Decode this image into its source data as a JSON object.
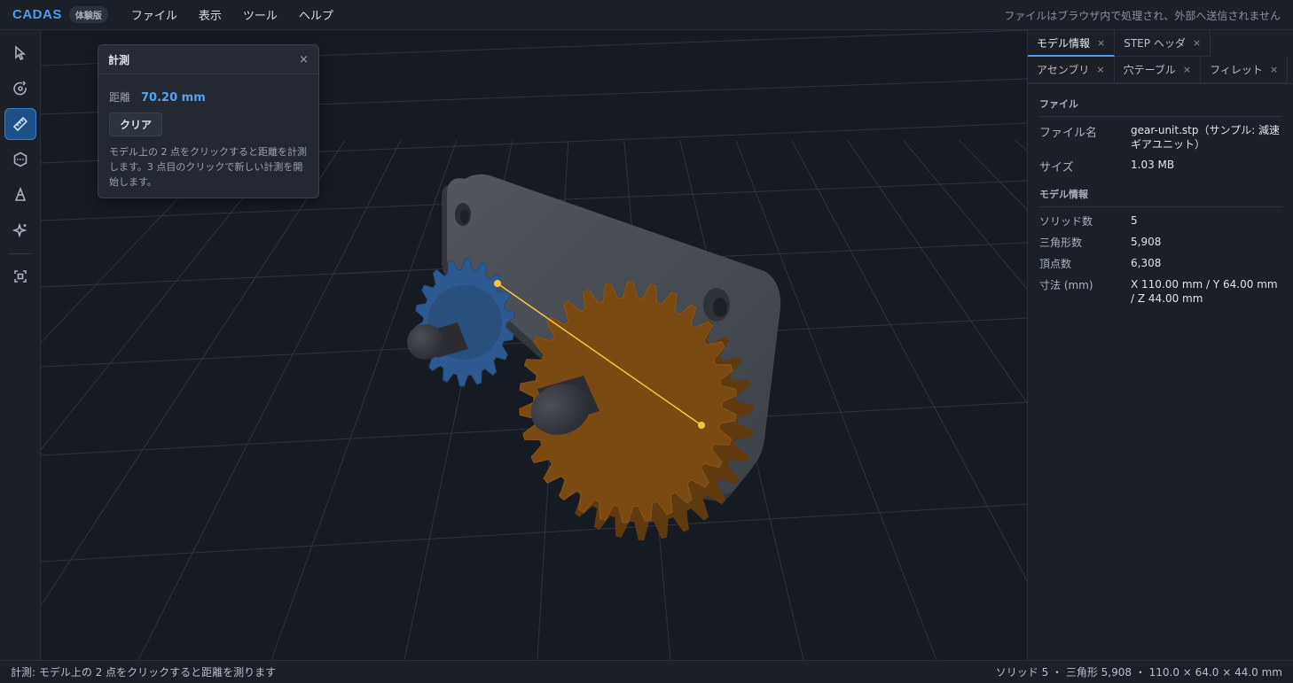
{
  "app": {
    "logo": "CADAS",
    "trial_badge": "体験版",
    "privacy_note": "ファイルはブラウザ内で処理され、外部へ送信されません"
  },
  "menu": [
    "ファイル",
    "表示",
    "ツール",
    "ヘルプ"
  ],
  "toolbar": {
    "tools": [
      {
        "name": "select-icon"
      },
      {
        "name": "orbit-icon"
      },
      {
        "name": "ruler-icon",
        "active": true
      },
      {
        "name": "section-icon"
      },
      {
        "name": "cone-icon"
      },
      {
        "name": "sparkle-icon"
      },
      {
        "name": "fit-view-icon"
      }
    ]
  },
  "measure": {
    "title": "計測",
    "close": "×",
    "distance_label": "距離",
    "distance_value": "70.20 mm",
    "clear_label": "クリア",
    "help": "モデル上の 2 点をクリックすると距離を計測します。3 点目のクリックで新しい計測を開始します。"
  },
  "tabs": [
    {
      "label": "モデル情報",
      "close": "×",
      "active": true
    },
    {
      "label": "STEP ヘッダ",
      "close": "×"
    },
    {
      "label": "アセンブリ",
      "close": "×"
    },
    {
      "label": "穴テーブル",
      "close": "×"
    },
    {
      "label": "フィレット",
      "close": "×"
    }
  ],
  "file_section": {
    "title": "ファイル",
    "rows": [
      {
        "key": "ファイル名",
        "value": "gear-unit.stp（サンプル: 減速ギアユニット）"
      },
      {
        "key": "サイズ",
        "value": "1.03 MB"
      }
    ]
  },
  "model_section": {
    "title": "モデル情報",
    "rows": [
      {
        "key": "ソリッド数",
        "value": "5"
      },
      {
        "key": "三角形数",
        "value": "5,908"
      },
      {
        "key": "頂点数",
        "value": "6,308"
      },
      {
        "key": "寸法 (mm)",
        "value": "X 110.00 mm / Y 64.00 mm / Z 44.00 mm"
      }
    ]
  },
  "status": {
    "left": "計測: モデル上の 2 点をクリックすると距離を測ります",
    "right": "ソリッド 5 ・ 三角形 5,908 ・ 110.0 × 64.0 × 44.0 mm"
  },
  "colors": {
    "accent": "#4e9bf0",
    "gear_large": "#7a4a12",
    "gear_small": "#2e5a92",
    "plate": "#464a52",
    "measure_line": "#f5c542"
  }
}
